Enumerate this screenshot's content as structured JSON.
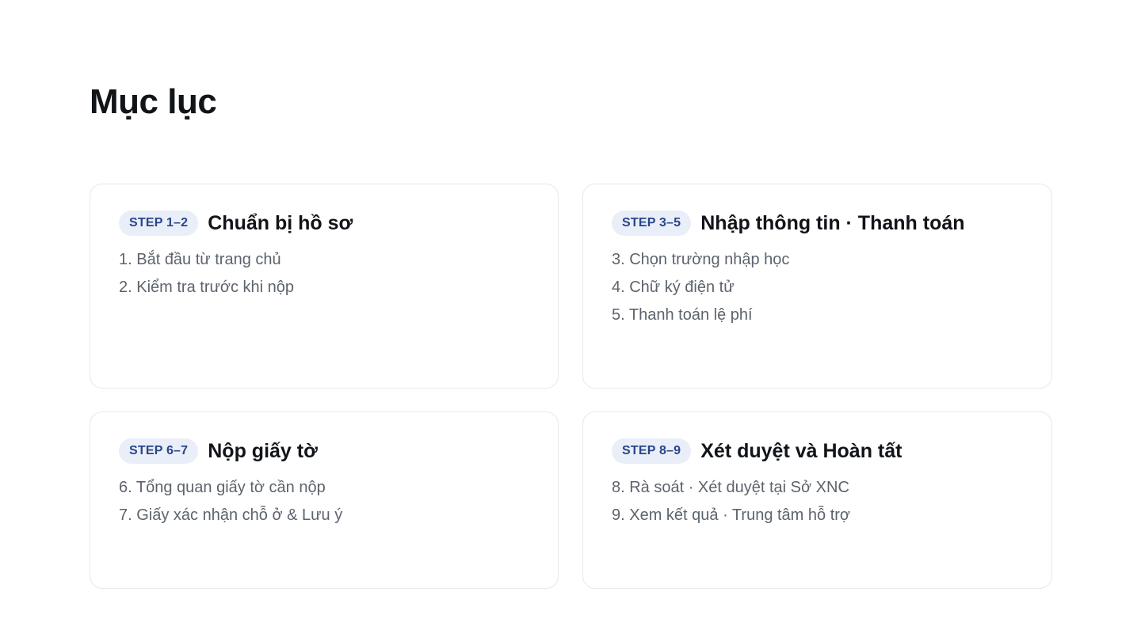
{
  "page": {
    "title": "Mục lục"
  },
  "cards": [
    {
      "badge": "STEP 1–2",
      "title": "Chuẩn bị hồ sơ",
      "items": [
        "1. Bắt đầu từ trang chủ",
        "2. Kiểm tra trước khi nộp"
      ]
    },
    {
      "badge": "STEP 3–5",
      "title": "Nhập thông tin · Thanh toán",
      "items": [
        "3. Chọn trường nhập học",
        "4. Chữ ký điện tử",
        "5. Thanh toán lệ phí"
      ]
    },
    {
      "badge": "STEP 6–7",
      "title": "Nộp giấy tờ",
      "items": [
        "6. Tổng quan giấy tờ cần nộp",
        "7. Giấy xác nhận chỗ ở & Lưu ý"
      ]
    },
    {
      "badge": "STEP 8–9",
      "title": "Xét duyệt và Hoàn tất",
      "items": [
        "8. Rà soát · Xét duyệt tại Sở XNC",
        "9. Xem kết quả · Trung tâm hỗ trợ"
      ]
    }
  ],
  "colors": {
    "badge_bg": "#e9eef8",
    "badge_text": "#27468a",
    "card_border": "#e6e8ec"
  }
}
